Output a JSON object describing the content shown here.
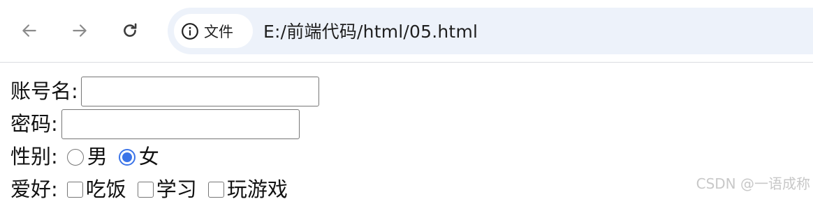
{
  "browser": {
    "site_chip_label": "文件",
    "url": "E:/前端代码/html/05.html"
  },
  "form": {
    "account": {
      "label": "账号名:",
      "value": ""
    },
    "password": {
      "label": "密码:",
      "value": ""
    },
    "gender": {
      "label": "性别:",
      "options": [
        {
          "label": "男",
          "checked": false
        },
        {
          "label": "女",
          "checked": true
        }
      ]
    },
    "hobbies": {
      "label": "爱好:",
      "options": [
        {
          "label": "吃饭",
          "checked": false
        },
        {
          "label": "学习",
          "checked": false
        },
        {
          "label": "玩游戏",
          "checked": false
        }
      ]
    }
  },
  "watermark": "CSDN @一语成称",
  "colors": {
    "accent": "#3b74e8",
    "address_bar": "#edf2fa",
    "nav_disabled": "#8a8a8a",
    "nav_enabled": "#3c3c3c"
  }
}
